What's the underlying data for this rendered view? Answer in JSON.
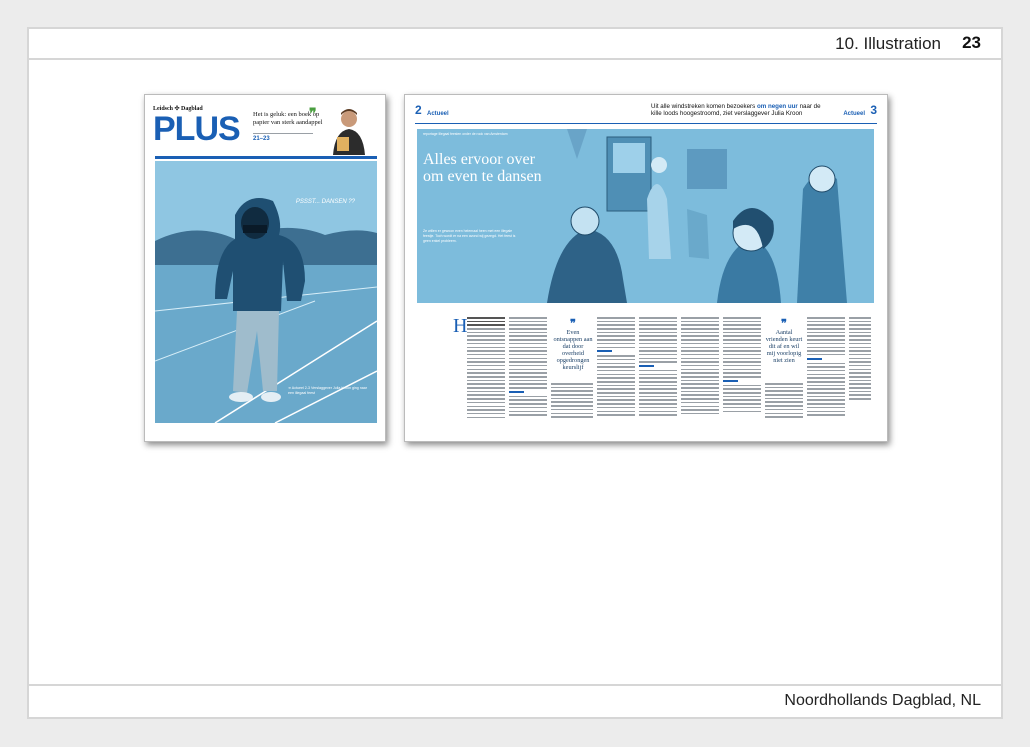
{
  "header": {
    "section_label": "10. Illustration",
    "page_number": "23"
  },
  "footer": {
    "credit": "Noordhollands Dagblad, NL"
  },
  "front_page": {
    "brand": "Leidsch ✣ Dagblad",
    "logo": "PLUS",
    "teaser_title": "Het is geluk: een boek op papier van sterk aandappel",
    "teaser_pages": "21–23",
    "art_text": "PSSST... DANSEN ??",
    "art_caption": "➔ Actueel 2-3 Verslaggever Julia Kroon ging naar een illegaal feest"
  },
  "spread": {
    "left_page_number": "2",
    "left_section": "Actueel",
    "headline_part1": "Uit alle windstreken komen bezoekers ",
    "headline_highlight": "om negen uur",
    "headline_part2": " naar de kille loods hoogestroomd, ziet verslaggever Julia Kroon",
    "right_page_number": "3",
    "right_section": "Actueel",
    "art_kicker": "reportage Illegaal feesten onder de rook van Amsterdam",
    "title": "Alles ervoor over om even te dansen",
    "intro": "Ze willen er gewoon even helemaal heen met een illegale feestje. Toch wordt er na een avond wij gezegd. Het feest is geen enkel probleem.",
    "dropcap": "H",
    "pull_quote_1": "Even ontsnappen aan dat door overheid opgedrongen keurslijf",
    "pull_quote_2": "Aantal vrienden keurt dit af en wil mij voorlopig niet zien"
  },
  "colors": {
    "accent_blue": "#1a5fb4",
    "illustration_blue": "#7dbcdc",
    "quote_green": "#4a9e3f"
  }
}
